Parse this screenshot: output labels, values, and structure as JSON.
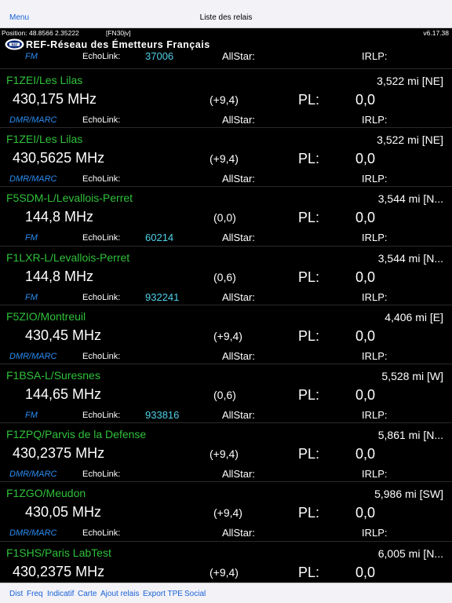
{
  "nav": {
    "menu": "Menu",
    "title": "Liste des relais"
  },
  "status": {
    "position": "Position: 48.8566 2.35222",
    "locator": "[FN30jv]",
    "version": "v6.17.38"
  },
  "banner": {
    "text": "REF-Réseau des Émetteurs Français"
  },
  "partial_row": {
    "mode": "FM",
    "echolink_label": "EchoLink:",
    "echolink": "37006",
    "allstar_label": "AllStar:",
    "irlp_label": "IRLP:"
  },
  "relays": [
    {
      "name": "F1ZEI/Les Lilas",
      "distance": "3,522 mi  [NE]",
      "frequency": "430,175 MHz",
      "shift": "(+9,4)",
      "pl_label": "PL:",
      "pl": "0,0",
      "mode": "DMR/MARC",
      "echolink_label": "EchoLink:",
      "echolink": "",
      "allstar_label": "AllStar:",
      "irlp_label": "IRLP:"
    },
    {
      "name": "F1ZEI/Les Lilas",
      "distance": "3,522 mi  [NE]",
      "frequency": "430,5625 MHz",
      "shift": "(+9,4)",
      "pl_label": "PL:",
      "pl": "0,0",
      "mode": "DMR/MARC",
      "echolink_label": "EchoLink:",
      "echolink": "",
      "allstar_label": "AllStar:",
      "irlp_label": "IRLP:"
    },
    {
      "name": "F5SDM-L/Levallois-Perret",
      "distance": "3,544 mi  [N...",
      "frequency": "144,8 MHz",
      "shift": "(0,0)",
      "pl_label": "PL:",
      "pl": "0,0",
      "mode": "FM",
      "echolink_label": "EchoLink:",
      "echolink": "60214",
      "allstar_label": "AllStar:",
      "irlp_label": "IRLP:"
    },
    {
      "name": "F1LXR-L/Levallois-Perret",
      "distance": "3,544 mi  [N...",
      "frequency": "144,8 MHz",
      "shift": "(0,6)",
      "pl_label": "PL:",
      "pl": "0,0",
      "mode": "FM",
      "echolink_label": "EchoLink:",
      "echolink": "932241",
      "allstar_label": "AllStar:",
      "irlp_label": "IRLP:"
    },
    {
      "name": "F5ZIO/Montreuil",
      "distance": "4,406 mi    [E]",
      "frequency": "430,45 MHz",
      "shift": "(+9,4)",
      "pl_label": "PL:",
      "pl": "0,0",
      "mode": "DMR/MARC",
      "echolink_label": "EchoLink:",
      "echolink": "",
      "allstar_label": "AllStar:",
      "irlp_label": "IRLP:"
    },
    {
      "name": "F1BSA-L/Suresnes",
      "distance": "5,528 mi   [W]",
      "frequency": "144,65 MHz",
      "shift": "(0,6)",
      "pl_label": "PL:",
      "pl": "0,0",
      "mode": "FM",
      "echolink_label": "EchoLink:",
      "echolink": "933816",
      "allstar_label": "AllStar:",
      "irlp_label": "IRLP:"
    },
    {
      "name": "F1ZPQ/Parvis de la Defense",
      "distance": "5,861 mi  [N...",
      "frequency": "430,2375 MHz",
      "shift": "(+9,4)",
      "pl_label": "PL:",
      "pl": "0,0",
      "mode": "DMR/MARC",
      "echolink_label": "EchoLink:",
      "echolink": "",
      "allstar_label": "AllStar:",
      "irlp_label": "IRLP:"
    },
    {
      "name": "F1ZGO/Meudon",
      "distance": "5,986 mi  [SW]",
      "frequency": "430,05 MHz",
      "shift": "(+9,4)",
      "pl_label": "PL:",
      "pl": "0,0",
      "mode": "DMR/MARC",
      "echolink_label": "EchoLink:",
      "echolink": "",
      "allstar_label": "AllStar:",
      "irlp_label": "IRLP:"
    },
    {
      "name": "F1SHS/Paris LabTest",
      "distance": "6,005 mi  [N...",
      "frequency": "430,2375 MHz",
      "shift": "(+9,4)",
      "pl_label": "PL:",
      "pl": "0,0",
      "mode": "",
      "echolink_label": "",
      "echolink": "",
      "allstar_label": "",
      "irlp_label": ""
    }
  ],
  "tabs": [
    "Dist",
    "Freq",
    "Indicatif",
    "Carte",
    "Ajout relais",
    "Export TPE",
    "Social"
  ],
  "colors": {
    "callsign": "#2fc13a",
    "mode": "#2a8cf0",
    "echolink_number": "#4fd0e8",
    "toolbar_link": "#1a62d6"
  },
  "icons": {
    "logo": "ref-logo-icon"
  }
}
